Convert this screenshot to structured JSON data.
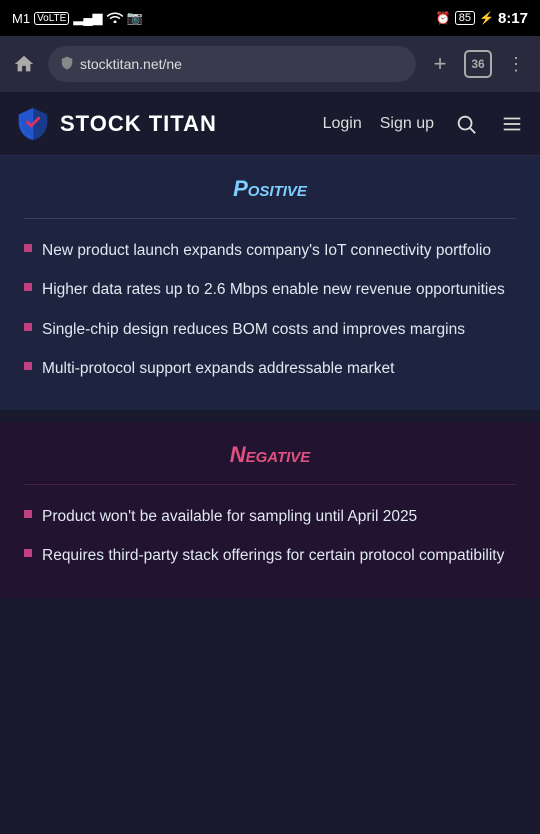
{
  "status_bar": {
    "carrier": "M1",
    "carrier_type": "VoLTE",
    "signal_bars": "▂▄▆",
    "wifi": "WiFi",
    "instagram": "IG",
    "alarm": "⏰",
    "battery": "85",
    "time": "8:17"
  },
  "browser": {
    "home_icon": "⌂",
    "address": "stocktitan.net/ne",
    "new_tab_icon": "+",
    "tab_count": "36",
    "menu_icon": "⋮"
  },
  "site_header": {
    "title": "STOCK TITAN",
    "login_label": "Login",
    "signup_label": "Sign up",
    "search_label": "Search",
    "menu_label": "Menu"
  },
  "positive_section": {
    "title": "Positive",
    "bullets": [
      "New product launch expands company's IoT connectivity portfolio",
      "Higher data rates up to 2.6 Mbps enable new revenue opportunities",
      "Single-chip design reduces BOM costs and improves margins",
      "Multi-protocol support expands addressable market"
    ]
  },
  "negative_section": {
    "title": "Negative",
    "bullets": [
      "Product won't be available for sampling until April 2025",
      "Requires third-party stack offerings for certain protocol compatibility"
    ]
  }
}
